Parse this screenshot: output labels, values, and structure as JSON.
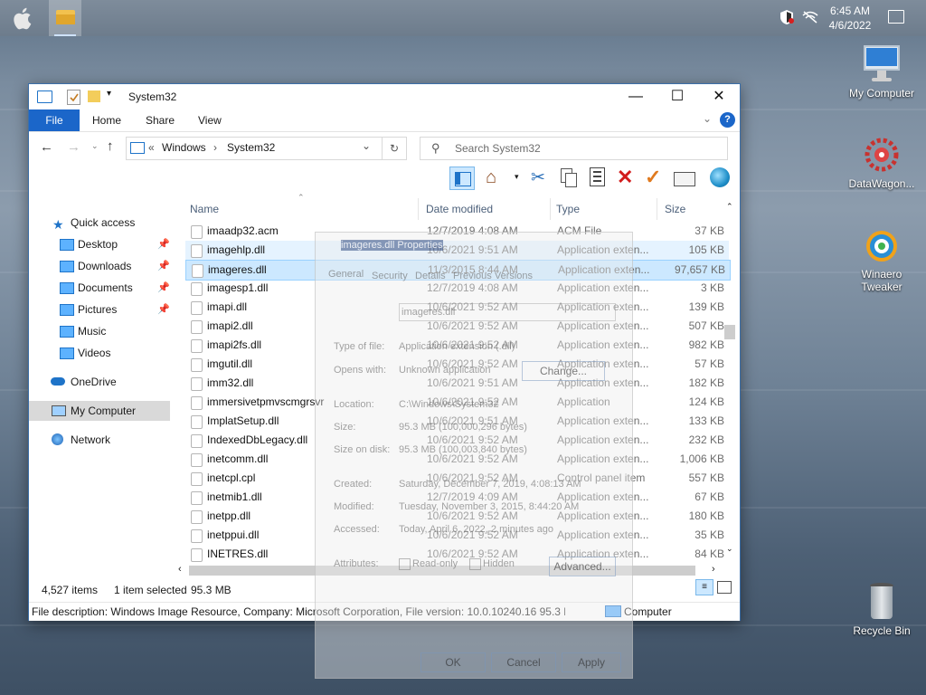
{
  "taskbar": {
    "time": "6:45 AM",
    "date": "4/6/2022"
  },
  "desktop_icons": [
    {
      "label": "My Computer",
      "icon": "monitor-icon"
    },
    {
      "label": "DataWagon...",
      "icon": "datawagon-icon"
    },
    {
      "label": "Winaero Tweaker",
      "icon": "winaero-icon"
    },
    {
      "label": "Recycle Bin",
      "icon": "recycle-bin-icon"
    }
  ],
  "window": {
    "title": "System32",
    "ribbon_tabs": [
      "File",
      "Home",
      "Share",
      "View"
    ],
    "breadcrumb": [
      "«",
      "Windows",
      "System32"
    ],
    "search_placeholder": "Search System32"
  },
  "nav": {
    "quick_access": "Quick access",
    "items": [
      {
        "label": "Desktop",
        "pinned": true
      },
      {
        "label": "Downloads",
        "pinned": true
      },
      {
        "label": "Documents",
        "pinned": true
      },
      {
        "label": "Pictures",
        "pinned": true
      },
      {
        "label": "Music",
        "pinned": false
      },
      {
        "label": "Videos",
        "pinned": false
      }
    ],
    "onedrive": "OneDrive",
    "my_computer": "My Computer",
    "network": "Network"
  },
  "columns": [
    "Name",
    "Date modified",
    "Type",
    "Size"
  ],
  "files": [
    {
      "name": "imaadp32.acm",
      "date": "12/7/2019 4:08 AM",
      "type": "ACM File",
      "size": "37 KB"
    },
    {
      "name": "imagehlp.dll",
      "date": "10/6/2021 9:51 AM",
      "type": "Application exten...",
      "size": "105 KB"
    },
    {
      "name": "imageres.dll",
      "date": "11/3/2015 8:44 AM",
      "type": "Application exten...",
      "size": "97,657 KB"
    },
    {
      "name": "imagesp1.dll",
      "date": "12/7/2019 4:08 AM",
      "type": "Application exten...",
      "size": "3 KB"
    },
    {
      "name": "imapi.dll",
      "date": "10/6/2021 9:52 AM",
      "type": "Application exten...",
      "size": "139 KB"
    },
    {
      "name": "imapi2.dll",
      "date": "10/6/2021 9:52 AM",
      "type": "Application exten...",
      "size": "507 KB"
    },
    {
      "name": "imapi2fs.dll",
      "date": "10/6/2021 9:52 AM",
      "type": "Application exten...",
      "size": "982 KB"
    },
    {
      "name": "imgutil.dll",
      "date": "10/6/2021 9:52 AM",
      "type": "Application exten...",
      "size": "57 KB"
    },
    {
      "name": "imm32.dll",
      "date": "10/6/2021 9:51 AM",
      "type": "Application exten...",
      "size": "182 KB"
    },
    {
      "name": "immersivetpmvscmgrsvr",
      "date": "10/6/2021 9:52 AM",
      "type": "Application",
      "size": "124 KB"
    },
    {
      "name": "ImplatSetup.dll",
      "date": "10/6/2021 9:51 AM",
      "type": "Application exten...",
      "size": "133 KB"
    },
    {
      "name": "IndexedDbLegacy.dll",
      "date": "10/6/2021 9:52 AM",
      "type": "Application exten...",
      "size": "232 KB"
    },
    {
      "name": "inetcomm.dll",
      "date": "10/6/2021 9:52 AM",
      "type": "Application exten...",
      "size": "1,006 KB"
    },
    {
      "name": "inetcpl.cpl",
      "date": "10/6/2021 9:52 AM",
      "type": "Control panel item",
      "size": "557 KB"
    },
    {
      "name": "inetmib1.dll",
      "date": "12/7/2019 4:09 AM",
      "type": "Application exten...",
      "size": "67 KB"
    },
    {
      "name": "inetpp.dll",
      "date": "10/6/2021 9:52 AM",
      "type": "Application exten...",
      "size": "180 KB"
    },
    {
      "name": "inetppui.dll",
      "date": "10/6/2021 9:52 AM",
      "type": "Application exten...",
      "size": "35 KB"
    },
    {
      "name": "INETRES.dll",
      "date": "10/6/2021 9:52 AM",
      "type": "Application exten...",
      "size": "84 KB"
    }
  ],
  "status": {
    "items": "4,527 items",
    "selected": "1 item selected",
    "size": "95.3 MB"
  },
  "details_bar": {
    "description": "File description: Windows Image Resource, Company: Microsoft Corporation, File version: 10.0.10240.16 95.3 MB",
    "location": "Computer"
  },
  "ghost_dialog": {
    "title": "imageres.dll Properties",
    "tabs": [
      "General",
      "Security",
      "Details",
      "Previous Versions"
    ],
    "filename": "imageres.dll",
    "fields": [
      {
        "label": "Type of file:",
        "value": "Application extension (.dll)"
      },
      {
        "label": "Opens with:",
        "value": "Unknown application"
      },
      {
        "label": "Location:",
        "value": "C:\\Windows\\System32"
      },
      {
        "label": "Size:",
        "value": "95.3 MB (100,000,296 bytes)"
      },
      {
        "label": "Size on disk:",
        "value": "95.3 MB (100,003,840 bytes)"
      },
      {
        "label": "Created:",
        "value": "Saturday, December 7, 2019, 4:08:13 AM"
      },
      {
        "label": "Modified:",
        "value": "Tuesday, November 3, 2015, 8:44:20 AM"
      },
      {
        "label": "Accessed:",
        "value": "Today, April 6, 2022, 2 minutes ago"
      }
    ],
    "change_button": "Change...",
    "attributes_label": "Attributes:",
    "readonly": "Read-only",
    "hidden": "Hidden",
    "advanced_button": "Advanced...",
    "ok": "OK",
    "cancel": "Cancel",
    "apply": "Apply"
  }
}
